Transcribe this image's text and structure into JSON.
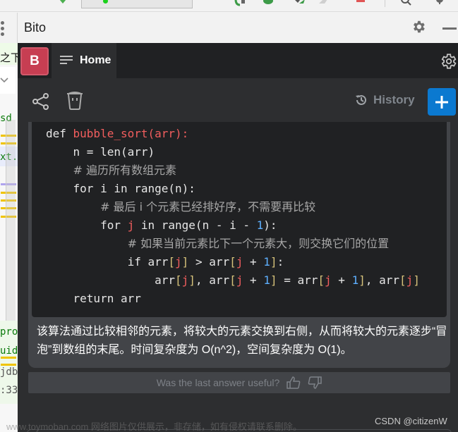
{
  "window": {
    "tool_window_title": "Bito"
  },
  "header": {
    "avatar_letter": "B",
    "home_tab_label": "Home"
  },
  "actions": {
    "history_label": "History",
    "new_chat_label": "+"
  },
  "code": {
    "language": "python",
    "lines": [
      {
        "indent": 0,
        "tokens": [
          {
            "t": "def ",
            "c": "kw"
          },
          {
            "t": "bubble_sort(arr):",
            "c": "fn"
          }
        ]
      },
      {
        "indent": 1,
        "tokens": [
          {
            "t": "n = len(arr)",
            "c": "kw"
          }
        ]
      },
      {
        "indent": 1,
        "tokens": [
          {
            "t": "# 遍历所有数组元素",
            "c": "cm"
          }
        ]
      },
      {
        "indent": 1,
        "tokens": [
          {
            "t": "for i in range(n):",
            "c": "kw"
          }
        ]
      },
      {
        "indent": 2,
        "tokens": [
          {
            "t": "# 最后 i 个元素已经排好序，不需要再比较",
            "c": "cm"
          }
        ]
      },
      {
        "indent": 2,
        "tokens": [
          {
            "t": "for ",
            "c": "kw"
          },
          {
            "t": "j",
            "c": "var"
          },
          {
            "t": " in range(n - i - ",
            "c": "kw"
          },
          {
            "t": "1",
            "c": "num"
          },
          {
            "t": "):",
            "c": "kw"
          }
        ]
      },
      {
        "indent": 3,
        "tokens": [
          {
            "t": "# 如果当前元素比下一个元素大，则交换它们的位置",
            "c": "cm"
          }
        ]
      },
      {
        "indent": 3,
        "tokens": [
          {
            "t": "if arr",
            "c": "kw"
          },
          {
            "t": "[",
            "c": "br"
          },
          {
            "t": "j",
            "c": "var"
          },
          {
            "t": "]",
            "c": "br"
          },
          {
            "t": " > arr",
            "c": "kw"
          },
          {
            "t": "[",
            "c": "br"
          },
          {
            "t": "j",
            "c": "var"
          },
          {
            "t": " + ",
            "c": "kw"
          },
          {
            "t": "1",
            "c": "num"
          },
          {
            "t": "]",
            "c": "br"
          },
          {
            "t": ":",
            "c": "kw"
          }
        ]
      },
      {
        "indent": 4,
        "tokens": [
          {
            "t": "arr",
            "c": "kw"
          },
          {
            "t": "[",
            "c": "br"
          },
          {
            "t": "j",
            "c": "var"
          },
          {
            "t": "]",
            "c": "br"
          },
          {
            "t": ", arr",
            "c": "kw"
          },
          {
            "t": "[",
            "c": "br"
          },
          {
            "t": "j",
            "c": "var"
          },
          {
            "t": " + ",
            "c": "kw"
          },
          {
            "t": "1",
            "c": "num"
          },
          {
            "t": "]",
            "c": "br"
          },
          {
            "t": " = arr",
            "c": "kw"
          },
          {
            "t": "[",
            "c": "br"
          },
          {
            "t": "j",
            "c": "var"
          },
          {
            "t": " + ",
            "c": "kw"
          },
          {
            "t": "1",
            "c": "num"
          },
          {
            "t": "]",
            "c": "br"
          },
          {
            "t": ", arr",
            "c": "kw"
          },
          {
            "t": "[",
            "c": "br"
          },
          {
            "t": "j",
            "c": "var"
          },
          {
            "t": "]",
            "c": "br"
          }
        ]
      },
      {
        "indent": 1,
        "tokens": [
          {
            "t": "return arr",
            "c": "kw"
          }
        ]
      }
    ]
  },
  "answer": {
    "explanation": "该算法通过比较相邻的元素，将较大的元素交换到右侧，从而将较大的元素逐步“冒泡”到数组的末尾。时间复杂度为 O(n^2)，空间复杂度为 O(1)。"
  },
  "feedback": {
    "question": "Was the last answer useful?"
  },
  "left_strip": {
    "fragments": [
      "之下",
      "sd",
      "xt.",
      "pro",
      "uid",
      "jdb",
      ":33"
    ]
  },
  "overlay": {
    "watermark": "www.toymoban.com 网络图片仅供展示，非存储，如有侵权请联系删除。",
    "credit": "CSDN @citizenW"
  },
  "colors": {
    "accent": "#0b79d0",
    "avatar": "#c73e52",
    "panel_bg": "#2d2e30",
    "code_bg": "#202123"
  }
}
